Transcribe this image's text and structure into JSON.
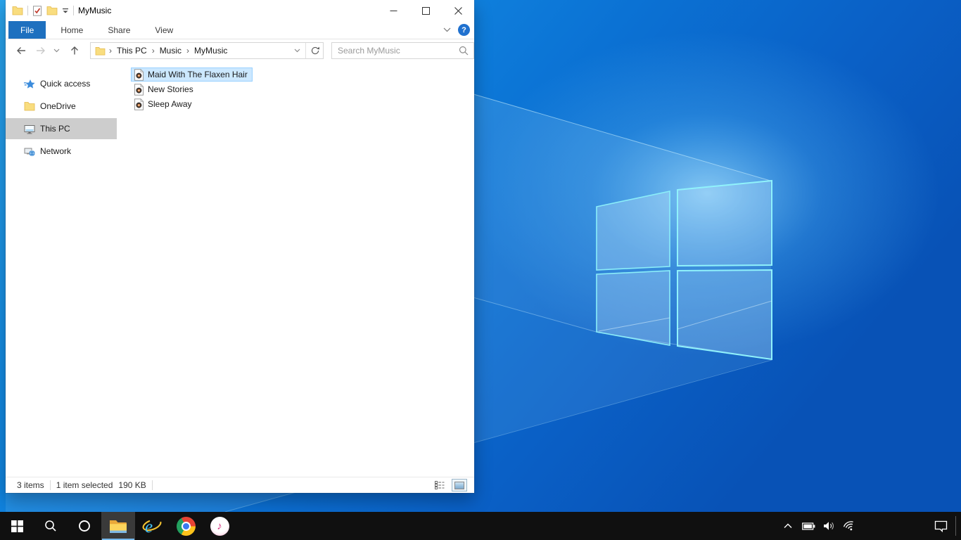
{
  "colors": {
    "accent_blue": "#1e70bf",
    "selection_fill": "#cce8ff",
    "selection_border": "#99d1ff",
    "sidebar_selected_bg": "#cdcdcd",
    "taskbar_bg": "#101010",
    "taskbar_active_underline": "#76b9ed",
    "wallpaper_base": "#0b72d4"
  },
  "explorer": {
    "window_title": "MyMusic",
    "qat_icons": [
      "app-folder-icon",
      "properties-check-icon",
      "new-folder-icon",
      "qat-dropdown-icon"
    ],
    "window_controls": [
      "minimize",
      "maximize",
      "close"
    ],
    "ribbon_tabs": [
      {
        "label": "File",
        "active": true
      },
      {
        "label": "Home",
        "active": false
      },
      {
        "label": "Share",
        "active": false
      },
      {
        "label": "View",
        "active": false
      }
    ],
    "ribbon_right_icons": [
      "expand-ribbon-chevron-icon",
      "help-icon"
    ],
    "nav_icons": [
      "back-icon",
      "forward-icon",
      "recent-locations-chevron-icon",
      "up-icon"
    ],
    "address": {
      "icon": "folder-icon",
      "breadcrumb": [
        "This PC",
        "Music",
        "MyMusic"
      ],
      "separator": "›",
      "right_icons": [
        "address-dropdown-chevron-icon",
        "refresh-icon"
      ]
    },
    "search": {
      "placeholder": "Search MyMusic",
      "icon": "magnifier-icon"
    },
    "sidebar": {
      "items": [
        {
          "label": "Quick access",
          "icon": "quick-access-star-icon",
          "selected": false
        },
        {
          "label": "OneDrive",
          "icon": "onedrive-folder-icon",
          "selected": false
        },
        {
          "label": "This PC",
          "icon": "this-pc-monitor-icon",
          "selected": true
        },
        {
          "label": "Network",
          "icon": "network-icon",
          "selected": false
        }
      ]
    },
    "files": {
      "items": [
        {
          "name": "Maid With The Flaxen Hair",
          "icon": "audio-file-icon",
          "selected": true
        },
        {
          "name": "New Stories",
          "icon": "audio-file-icon",
          "selected": false
        },
        {
          "name": "Sleep Away",
          "icon": "audio-file-icon",
          "selected": false
        }
      ]
    },
    "status_bar": {
      "item_count": "3 items",
      "selection_info": "1 item selected",
      "selection_size": "190 KB",
      "view_buttons": [
        "details-view-icon",
        "thumbnail-view-icon"
      ],
      "active_view": "thumbnail-view"
    }
  },
  "taskbar": {
    "items": [
      "start-icon",
      "search-icon",
      "cortana-icon",
      "file-explorer-icon",
      "internet-explorer-icon",
      "chrome-icon",
      "itunes-icon"
    ],
    "active_item": "file-explorer-icon",
    "tray_icons": [
      "tray-chevron-up-icon",
      "battery-icon",
      "volume-icon",
      "wifi-icon",
      "action-center-icon",
      "show-desktop-divider"
    ]
  }
}
